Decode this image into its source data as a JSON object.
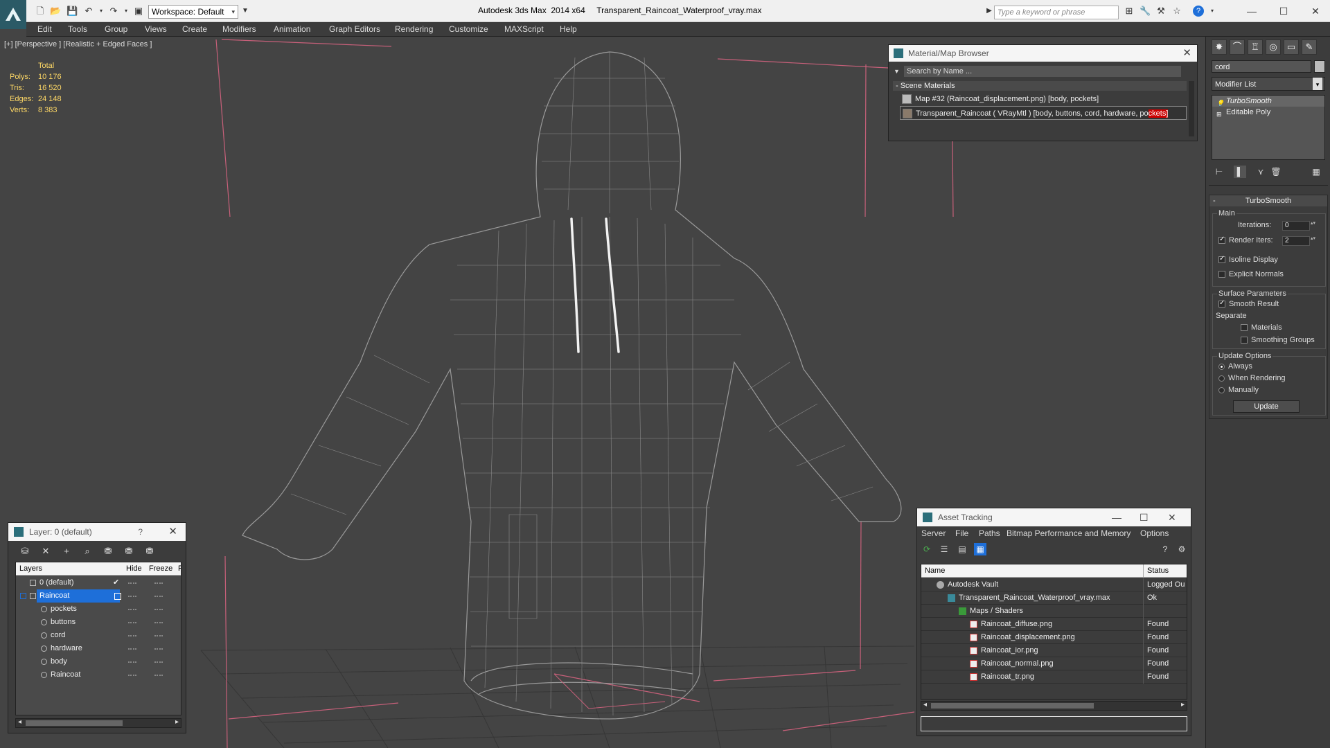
{
  "titlebar": {
    "app_title": "Autodesk 3ds Max  2014 x64",
    "file_title": "Transparent_Raincoat_Waterproof_vray.max",
    "workspace": "Workspace: Default",
    "search_placeholder": "Type a keyword or phrase"
  },
  "menu": [
    "Edit",
    "Tools",
    "Group",
    "Views",
    "Create",
    "Modifiers",
    "Animation",
    "Graph Editors",
    "Rendering",
    "Customize",
    "MAXScript",
    "Help"
  ],
  "viewport": {
    "label": "[+] [Perspective ] [Realistic + Edged Faces ]",
    "stats": {
      "header": "Total",
      "rows": [
        {
          "k": "Polys:",
          "v": "10 176"
        },
        {
          "k": "Tris:",
          "v": "16 520"
        },
        {
          "k": "Edges:",
          "v": "24 148"
        },
        {
          "k": "Verts:",
          "v": "8 383"
        }
      ]
    }
  },
  "material_browser": {
    "title": "Material/Map Browser",
    "search": "Search by Name ...",
    "group": "- Scene Materials",
    "rows": [
      {
        "label": "Map #32 (Raincoat_displacement.png) [body, pockets]"
      },
      {
        "label_main": "Transparent_Raincoat  ( VRayMtl )  [body, buttons, cord, hardware, po",
        "label_hl": "ckets]"
      }
    ]
  },
  "command_panel": {
    "object_name": "cord",
    "modifier_list": "Modifier List",
    "stack": [
      "TurboSmooth",
      "Editable Poly"
    ],
    "rollout_title": "TurboSmooth",
    "main_group": "Main",
    "iterations_label": "Iterations:",
    "iterations_value": "0",
    "render_iters_label": "Render Iters:",
    "render_iters_value": "2",
    "isoline_display": "Isoline Display",
    "explicit_normals": "Explicit Normals",
    "surface_group": "Surface Parameters",
    "smooth_result": "Smooth Result",
    "separate": "Separate",
    "materials": "Materials",
    "smoothing_groups": "Smoothing Groups",
    "update_group": "Update Options",
    "always": "Always",
    "when_rendering": "When Rendering",
    "manually": "Manually",
    "update_button": "Update"
  },
  "layer_dialog": {
    "title": "Layer: 0 (default)",
    "help": "?",
    "columns": {
      "layers": "Layers",
      "hide": "Hide",
      "freeze": "Freeze",
      "r": "R"
    },
    "rows": [
      {
        "name": "0 (default)"
      },
      {
        "name": "Raincoat"
      },
      {
        "name": "pockets"
      },
      {
        "name": "buttons"
      },
      {
        "name": "cord"
      },
      {
        "name": "hardware"
      },
      {
        "name": "body"
      },
      {
        "name": "Raincoat"
      }
    ]
  },
  "asset_tracking": {
    "title": "Asset Tracking",
    "menu": [
      "Server",
      "File",
      "Paths",
      "Bitmap Performance and Memory",
      "Options"
    ],
    "columns": {
      "name": "Name",
      "status": "Status"
    },
    "rows": [
      {
        "name": "Autodesk Vault",
        "status": "Logged Ou"
      },
      {
        "name": "Transparent_Raincoat_Waterproof_vray.max",
        "status": "Ok"
      },
      {
        "name": "Maps / Shaders",
        "status": ""
      },
      {
        "name": "Raincoat_diffuse.png",
        "status": "Found"
      },
      {
        "name": "Raincoat_displacement.png",
        "status": "Found"
      },
      {
        "name": "Raincoat_ior.png",
        "status": "Found"
      },
      {
        "name": "Raincoat_normal.png",
        "status": "Found"
      },
      {
        "name": "Raincoat_tr.png",
        "status": "Found"
      }
    ]
  },
  "colors": {
    "viewport_bg": "#444444",
    "selection": "#1e6fd9",
    "stats_text": "#ffd966",
    "highlight_red": "#cc0000"
  }
}
